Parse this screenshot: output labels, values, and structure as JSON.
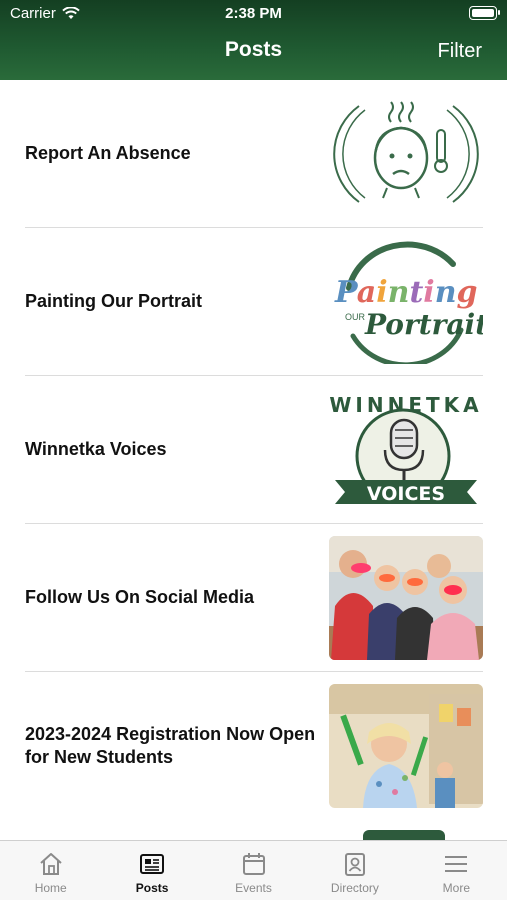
{
  "status_bar": {
    "carrier": "Carrier",
    "time": "2:38 PM"
  },
  "header": {
    "title": "Posts",
    "filter_label": "Filter"
  },
  "posts": [
    {
      "title": "Report An Absence",
      "thumb": "sick-face-thermometer-icon"
    },
    {
      "title": "Painting Our Portrait",
      "thumb": "painting-our-portrait-logo",
      "thumb_text": "Painting OUR Portrait"
    },
    {
      "title": "Winnetka Voices",
      "thumb": "winnetka-voices-logo",
      "thumb_text": "WINNETKA VOICES"
    },
    {
      "title": "Follow Us On Social Media",
      "thumb": "kids-photo"
    },
    {
      "title": "2023-2024 Registration Now Open for New Students",
      "thumb": "child-classroom-photo"
    }
  ],
  "tabs": [
    {
      "label": "Home",
      "icon": "home-icon",
      "active": false
    },
    {
      "label": "Posts",
      "icon": "news-icon",
      "active": true
    },
    {
      "label": "Events",
      "icon": "calendar-icon",
      "active": false
    },
    {
      "label": "Directory",
      "icon": "contact-card-icon",
      "active": false
    },
    {
      "label": "More",
      "icon": "menu-icon",
      "active": false
    }
  ],
  "colors": {
    "header_green": "#1f5a31",
    "accent_green": "#3a6b4a"
  }
}
